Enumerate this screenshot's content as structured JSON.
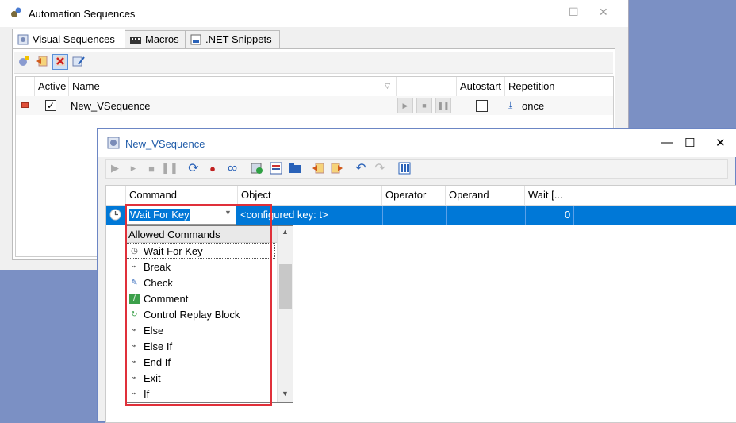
{
  "back_window": {
    "title": "Automation Sequences",
    "controls": {
      "minimize": "—",
      "maximize": "☐",
      "close": "✕"
    },
    "tabs": [
      {
        "label": "Visual Sequences",
        "icon": "gear-icon"
      },
      {
        "label": "Macros",
        "icon": "keyboard-icon"
      },
      {
        "label": ".NET Snippets",
        "icon": "net-icon"
      }
    ],
    "toolbar_icons": [
      "new-sequence-icon",
      "import-icon",
      "delete-icon",
      "edit-icon"
    ],
    "columns": [
      "Active",
      "Name",
      "Autostart",
      "Repetition"
    ],
    "rows": [
      {
        "active": true,
        "name": "New_VSequence",
        "autostart": false,
        "repetition": "once"
      }
    ]
  },
  "front_window": {
    "title": "New_VSequence",
    "controls": {
      "minimize": "—",
      "maximize": "☐",
      "close": "✕"
    },
    "toolbar_icons": [
      "play-icon",
      "step-icon",
      "stop-icon",
      "pause-icon",
      "loop-icon",
      "record-icon",
      "infinite-icon",
      "validate-icon",
      "properties-icon",
      "open-icon",
      "import-icon",
      "export-icon",
      "undo-icon",
      "redo-icon",
      "layout-icon"
    ],
    "columns": [
      "Command",
      "Object",
      "Operator",
      "Operand",
      "Wait [..."
    ],
    "row": {
      "command": "Wait For Key",
      "object": "<configured key: t>",
      "operator": "",
      "operand": "",
      "wait": "0"
    },
    "dropdown": {
      "header": "Allowed Commands",
      "items": [
        "Wait For Key",
        "Break",
        "Check",
        "Comment",
        "Control Replay Block",
        "Else",
        "Else If",
        "End If",
        "Exit",
        "If"
      ]
    }
  },
  "colors": {
    "selection": "#0078d7",
    "highlight_box": "#e0303a",
    "title_blue": "#1f5ba8"
  }
}
